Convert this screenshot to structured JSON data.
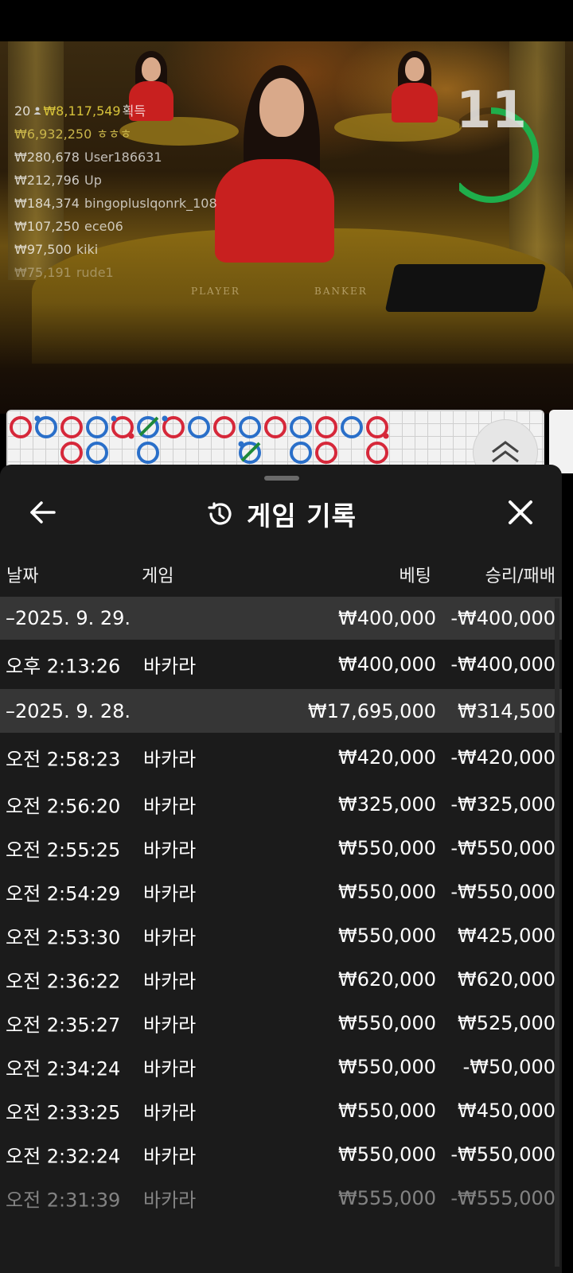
{
  "video": {
    "timer": "11",
    "timer_color": "#1fae4b",
    "table_labels": [
      "PLAYER",
      "BANKER"
    ],
    "winners_header": {
      "count": "20",
      "amount": "₩8,117,549",
      "label": "획득"
    },
    "winners": [
      {
        "amount": "₩6,932,250",
        "name": "ㅎㅎㅎ"
      },
      {
        "amount": "₩280,678",
        "name": "User186631"
      },
      {
        "amount": "₩212,796",
        "name": "Up"
      },
      {
        "amount": "₩184,374",
        "name": "bingopluslqonrk_108"
      },
      {
        "amount": "₩107,250",
        "name": "ece06"
      },
      {
        "amount": "₩97,500",
        "name": "kiki"
      },
      {
        "amount": "₩75,191",
        "name": "rude1"
      }
    ]
  },
  "roadmap": {
    "banker_color": "#d6283a",
    "player_color": "#2a6fc9",
    "tie_color": "#1f8a3a"
  },
  "sheet": {
    "title": "게임 기록",
    "columns": {
      "date": "날짜",
      "game": "게임",
      "bet": "베팅",
      "winloss": "승리/패배"
    },
    "rows": [
      {
        "type": "date",
        "date": "–2025. 9. 29.",
        "game": "",
        "bet": "₩400,000",
        "winloss": "-₩400,000"
      },
      {
        "type": "entry",
        "date": "오후 2:13:26",
        "game": "바카라",
        "bet": "₩400,000",
        "winloss": "-₩400,000"
      },
      {
        "type": "date",
        "date": "–2025. 9. 28.",
        "game": "",
        "bet": "₩17,695,000",
        "winloss": "₩314,500"
      },
      {
        "type": "entry",
        "date": "오전 2:58:23",
        "game": "바카라",
        "bet": "₩420,000",
        "winloss": "-₩420,000"
      },
      {
        "type": "entry",
        "date": "오전 2:56:20",
        "game": "바카라",
        "bet": "₩325,000",
        "winloss": "-₩325,000"
      },
      {
        "type": "entry",
        "date": "오전 2:55:25",
        "game": "바카라",
        "bet": "₩550,000",
        "winloss": "-₩550,000"
      },
      {
        "type": "entry",
        "date": "오전 2:54:29",
        "game": "바카라",
        "bet": "₩550,000",
        "winloss": "-₩550,000"
      },
      {
        "type": "entry",
        "date": "오전 2:53:30",
        "game": "바카라",
        "bet": "₩550,000",
        "winloss": "₩425,000"
      },
      {
        "type": "entry",
        "date": "오전 2:36:22",
        "game": "바카라",
        "bet": "₩620,000",
        "winloss": "₩620,000"
      },
      {
        "type": "entry",
        "date": "오전 2:35:27",
        "game": "바카라",
        "bet": "₩550,000",
        "winloss": "₩525,000"
      },
      {
        "type": "entry",
        "date": "오전 2:34:24",
        "game": "바카라",
        "bet": "₩550,000",
        "winloss": "-₩50,000"
      },
      {
        "type": "entry",
        "date": "오전 2:33:25",
        "game": "바카라",
        "bet": "₩550,000",
        "winloss": "₩450,000"
      },
      {
        "type": "entry",
        "date": "오전 2:32:24",
        "game": "바카라",
        "bet": "₩550,000",
        "winloss": "-₩550,000"
      },
      {
        "type": "entry",
        "date": "오전 2:31:39",
        "game": "바카라",
        "bet": "₩555,000",
        "winloss": "-₩555,000"
      }
    ]
  }
}
